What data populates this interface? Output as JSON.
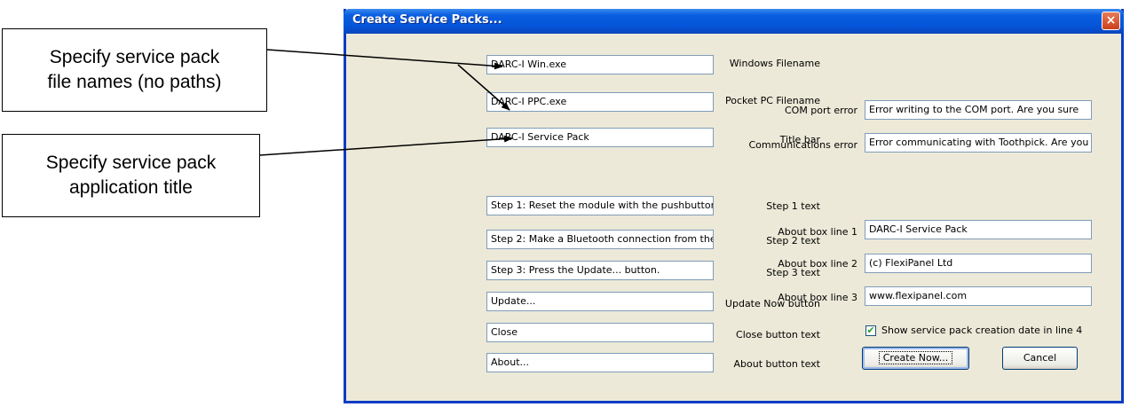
{
  "callouts": [
    {
      "line1": "Specify service pack",
      "line2": "file names (no paths)"
    },
    {
      "line1": "Specify service pack",
      "line2": "application title"
    }
  ],
  "window": {
    "title": "Create Service Packs...",
    "close_glyph": "×"
  },
  "left_fields": [
    {
      "label": "Windows Filename",
      "value": "DARC-I Win.exe"
    },
    {
      "label": "Pocket PC Filename",
      "value": "DARC-I PPC.exe"
    },
    {
      "label": "Title bar",
      "value": "DARC-I Service Pack"
    },
    {
      "label": "Step 1 text",
      "value": "Step 1: Reset the module with the pushbutton"
    },
    {
      "label": "Step 2 text",
      "value": "Step 2: Make a Bluetooth connection from the"
    },
    {
      "label": "Step 3 text",
      "value": "Step 3: Press the Update... button."
    },
    {
      "label": "Update Now button",
      "value": "Update..."
    },
    {
      "label": "Close button text",
      "value": "Close"
    },
    {
      "label": "About button text",
      "value": "About..."
    }
  ],
  "right_fields": [
    {
      "label": "COM port error",
      "value": "Error writing to the COM port.  Are you sure"
    },
    {
      "label": "Communications error",
      "value": "Error communicating with Toothpick.  Are you"
    },
    {
      "label": "About box line 1",
      "value": "DARC-I Service Pack"
    },
    {
      "label": "About box line 2",
      "value": "(c) FlexiPanel Ltd"
    },
    {
      "label": "About box line 3",
      "value": "www.flexipanel.com"
    }
  ],
  "checkbox": {
    "label": "Show service pack creation date in line 4",
    "checked": true,
    "mark": "✔"
  },
  "buttons": {
    "create": "Create Now...",
    "cancel": "Cancel"
  },
  "colors": {
    "titlebar": "#0454D8",
    "dialog_bg": "#ECE9D8",
    "field_border": "#7F9DB9",
    "close": "#C9401B"
  }
}
